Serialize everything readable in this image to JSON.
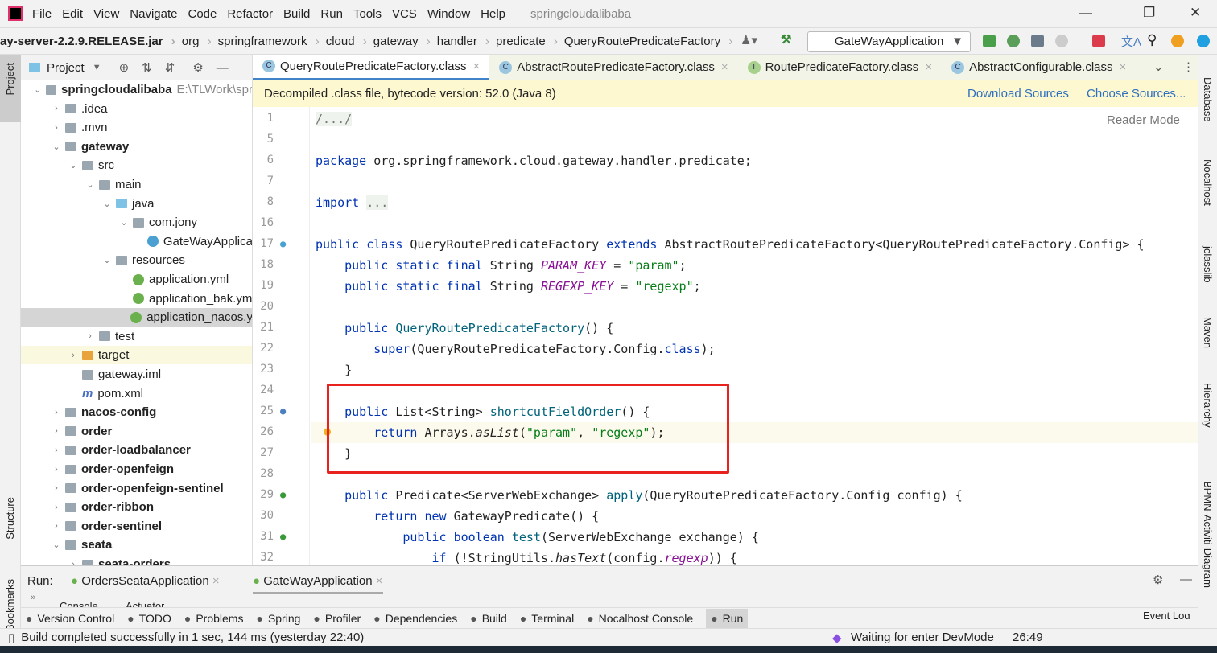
{
  "title": {
    "app": "springcloudalibaba",
    "menus": [
      "File",
      "Edit",
      "View",
      "Navigate",
      "Code",
      "Refactor",
      "Build",
      "Run",
      "Tools",
      "VCS",
      "Window",
      "Help"
    ]
  },
  "breadcrumb": [
    "ay-server-2.2.9.RELEASE.jar",
    "org",
    "springframework",
    "cloud",
    "gateway",
    "handler",
    "predicate",
    "QueryRoutePredicateFactory"
  ],
  "run_config": "GateWayApplication",
  "left_strip": [
    "Project",
    "Structure",
    "Bookmarks"
  ],
  "right_strip": [
    "Database",
    "Nocalhost",
    "jclasslib",
    "Maven",
    "Hierarchy",
    "BPMN-Activiti-Diagram"
  ],
  "project": {
    "title": "Project",
    "tree": [
      {
        "label": "springcloudalibaba",
        "extra": "E:\\TLWork\\spr",
        "level": 0,
        "arrow": "v",
        "icon": "folder",
        "bold": true
      },
      {
        "label": ".idea",
        "level": 1,
        "arrow": ">",
        "icon": "folder"
      },
      {
        "label": ".mvn",
        "level": 1,
        "arrow": ">",
        "icon": "folder"
      },
      {
        "label": "gateway",
        "level": 1,
        "arrow": "v",
        "icon": "folder",
        "bold": true
      },
      {
        "label": "src",
        "level": 2,
        "arrow": "v",
        "icon": "folder"
      },
      {
        "label": "main",
        "level": 3,
        "arrow": "v",
        "icon": "folder"
      },
      {
        "label": "java",
        "level": 4,
        "arrow": "v",
        "icon": "folder-blue"
      },
      {
        "label": "com.jony",
        "level": 5,
        "arrow": "v",
        "icon": "folder"
      },
      {
        "label": "GateWayApplica",
        "level": 6,
        "arrow": "",
        "icon": "class"
      },
      {
        "label": "resources",
        "level": 4,
        "arrow": "v",
        "icon": "folder"
      },
      {
        "label": "application.yml",
        "level": 5,
        "arrow": "",
        "icon": "spring"
      },
      {
        "label": "application_bak.ym",
        "level": 5,
        "arrow": "",
        "icon": "spring"
      },
      {
        "label": "application_nacos.y",
        "level": 5,
        "arrow": "",
        "icon": "spring",
        "selected": true
      },
      {
        "label": "test",
        "level": 3,
        "arrow": ">",
        "icon": "folder"
      },
      {
        "label": "target",
        "level": 2,
        "arrow": ">",
        "icon": "folder-orange",
        "highlight": true
      },
      {
        "label": "gateway.iml",
        "level": 2,
        "arrow": "",
        "icon": "file"
      },
      {
        "label": "pom.xml",
        "level": 2,
        "arrow": "",
        "icon": "maven"
      },
      {
        "label": "nacos-config",
        "level": 1,
        "arrow": ">",
        "icon": "folder",
        "bold": true
      },
      {
        "label": "order",
        "level": 1,
        "arrow": ">",
        "icon": "folder",
        "bold": true
      },
      {
        "label": "order-loadbalancer",
        "level": 1,
        "arrow": ">",
        "icon": "folder",
        "bold": true
      },
      {
        "label": "order-openfeign",
        "level": 1,
        "arrow": ">",
        "icon": "folder",
        "bold": true
      },
      {
        "label": "order-openfeign-sentinel",
        "level": 1,
        "arrow": ">",
        "icon": "folder",
        "bold": true
      },
      {
        "label": "order-ribbon",
        "level": 1,
        "arrow": ">",
        "icon": "folder",
        "bold": true
      },
      {
        "label": "order-sentinel",
        "level": 1,
        "arrow": ">",
        "icon": "folder",
        "bold": true
      },
      {
        "label": "seata",
        "level": 1,
        "arrow": "v",
        "icon": "folder",
        "bold": true
      },
      {
        "label": "seata-orders",
        "level": 2,
        "arrow": ">",
        "icon": "folder",
        "bold": true
      }
    ]
  },
  "tabs": [
    {
      "label": "QueryRoutePredicateFactory.class",
      "icon": "C",
      "active": true
    },
    {
      "label": "AbstractRoutePredicateFactory.class",
      "icon": "C"
    },
    {
      "label": "RoutePredicateFactory.class",
      "icon": "I"
    },
    {
      "label": "AbstractConfigurable.class",
      "icon": "C"
    }
  ],
  "banner": {
    "text": "Decompiled .class file, bytecode version: 52.0 (Java 8)",
    "download": "Download Sources",
    "choose": "Choose Sources..."
  },
  "reader_mode": "Reader Mode",
  "code": [
    {
      "n": "1",
      "t": [
        [
          "fold-t",
          "/.../"
        ]
      ]
    },
    {
      "n": "5",
      "t": []
    },
    {
      "n": "6",
      "t": [
        [
          "kw",
          "package "
        ],
        [
          "",
          "org.springframework.cloud.gateway.handler.predicate;"
        ]
      ]
    },
    {
      "n": "7",
      "t": []
    },
    {
      "n": "8",
      "t": [
        [
          "kw",
          "import "
        ],
        [
          "fold-t",
          "..."
        ]
      ]
    },
    {
      "n": "16",
      "t": []
    },
    {
      "n": "17",
      "t": [
        [
          "kw",
          "public class "
        ],
        [
          "",
          "QueryRoutePredicateFactory "
        ],
        [
          "kw",
          "extends "
        ],
        [
          "",
          "AbstractRoutePredicateFactory<QueryRoutePredicateFactory.Config> {"
        ]
      ]
    },
    {
      "n": "18",
      "t": [
        [
          "kw",
          "    public static final "
        ],
        [
          "",
          "String "
        ],
        [
          "fld",
          "PARAM_KEY"
        ],
        [
          "",
          " = "
        ],
        [
          "str",
          "\"param\""
        ],
        [
          "",
          ";"
        ]
      ]
    },
    {
      "n": "19",
      "t": [
        [
          "kw",
          "    public static final "
        ],
        [
          "",
          "String "
        ],
        [
          "fld",
          "REGEXP_KEY"
        ],
        [
          "",
          " = "
        ],
        [
          "str",
          "\"regexp\""
        ],
        [
          "",
          ";"
        ]
      ]
    },
    {
      "n": "20",
      "t": []
    },
    {
      "n": "21",
      "t": [
        [
          "kw",
          "    public "
        ],
        [
          "meth",
          "QueryRoutePredicateFactory"
        ],
        [
          "",
          "() {"
        ]
      ]
    },
    {
      "n": "22",
      "t": [
        [
          "kw",
          "        super"
        ],
        [
          "",
          "(QueryRoutePredicateFactory.Config."
        ],
        [
          "kw",
          "class"
        ],
        [
          "",
          ");"
        ]
      ]
    },
    {
      "n": "23",
      "t": [
        [
          "",
          "    }"
        ]
      ]
    },
    {
      "n": "24",
      "t": []
    },
    {
      "n": "25",
      "t": [
        [
          "kw",
          "    public "
        ],
        [
          "",
          "List<String> "
        ],
        [
          "meth",
          "shortcutFieldOrder"
        ],
        [
          "",
          "() {"
        ]
      ]
    },
    {
      "n": "26",
      "t": [
        [
          "kw",
          "        return "
        ],
        [
          "",
          "Arrays."
        ],
        [
          "ital",
          "asList"
        ],
        [
          "",
          "("
        ],
        [
          "str",
          "\"param\""
        ],
        [
          "",
          ", "
        ],
        [
          "str",
          "\"regexp\""
        ],
        [
          "",
          ");"
        ]
      ],
      "current": true
    },
    {
      "n": "27",
      "t": [
        [
          "",
          "    }"
        ]
      ]
    },
    {
      "n": "28",
      "t": []
    },
    {
      "n": "29",
      "t": [
        [
          "kw",
          "    public "
        ],
        [
          "",
          "Predicate<ServerWebExchange> "
        ],
        [
          "meth",
          "apply"
        ],
        [
          "",
          "(QueryRoutePredicateFactory.Config config) {"
        ]
      ]
    },
    {
      "n": "30",
      "t": [
        [
          "kw",
          "        return new "
        ],
        [
          "",
          "GatewayPredicate() {"
        ]
      ]
    },
    {
      "n": "31",
      "t": [
        [
          "kw",
          "            public boolean "
        ],
        [
          "meth",
          "test"
        ],
        [
          "",
          "(ServerWebExchange exchange) {"
        ]
      ]
    },
    {
      "n": "32",
      "t": [
        [
          "kw",
          "                if "
        ],
        [
          "",
          "(!StringUtils."
        ],
        [
          "ital",
          "hasText"
        ],
        [
          "",
          "(config."
        ],
        [
          "fld",
          "regexp"
        ],
        [
          "",
          ")) {"
        ]
      ]
    }
  ],
  "run": {
    "label": "Run:",
    "tabs": [
      "OrdersSeataApplication",
      "GateWayApplication"
    ],
    "subtabs": [
      "Console",
      "Actuator"
    ]
  },
  "toolwindows": [
    "Version Control",
    "TODO",
    "Problems",
    "Spring",
    "Profiler",
    "Dependencies",
    "Build",
    "Terminal",
    "Nocalhost Console",
    "Run"
  ],
  "event_log": "Event Log",
  "status": {
    "message": "Build completed successfully in 1 sec, 144 ms (yesterday 22:40)",
    "devmode": "Waiting for enter DevMode",
    "position": "26:49"
  },
  "colors": {
    "keyword": "#0033b3",
    "string": "#067d17",
    "field": "#871094",
    "highlight_box": "#e8231e",
    "link": "#2f6fc0"
  }
}
